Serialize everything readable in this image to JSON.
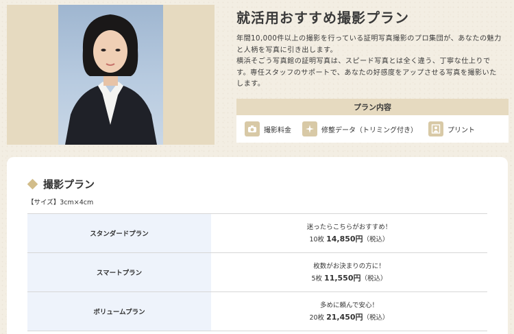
{
  "header": {
    "title": "就活用おすすめ撮影プラン",
    "description_lines": [
      "年間10,000件以上の撮影を行っている証明写真撮影のプロ集団が、あなたの魅力",
      "と人柄を写真に引き出します。",
      "横浜そごう写真館の証明写真は、スピード写真とは全く違う、丁寧な仕上りで",
      "す。専任スタッフのサポートで、あなたの好感度をアップさせる写真を撮影いた",
      "します。"
    ]
  },
  "plan_contents": {
    "heading": "プラン内容",
    "items": [
      {
        "icon": "camera-icon",
        "label": "撮影料金"
      },
      {
        "icon": "sparkle-icon",
        "label": "修整データ（トリミング付き）"
      },
      {
        "icon": "portrait-icon",
        "label": "プリント"
      }
    ]
  },
  "shooting_plan": {
    "title": "撮影プラン",
    "size_label": "【サイズ】3cm×4cm",
    "plans": [
      {
        "name": "スタンダードプラン",
        "tagline": "迷ったらこちらがおすすめ！",
        "count": "10枚",
        "price": "14,850円",
        "tax": "（税込）"
      },
      {
        "name": "スマートプラン",
        "tagline": "枚数がお決まりの方に！",
        "count": "5枚",
        "price": "11,550円",
        "tax": "（税込）"
      },
      {
        "name": "ボリュームプラン",
        "tagline": "多めに頼んで安心！",
        "count": "20枚",
        "price": "21,450円",
        "tax": "（税込）"
      }
    ]
  },
  "colors": {
    "page_bg": "#f3eee3",
    "accent_beige": "#e6dac0",
    "icon_bg": "#d8c9a6",
    "row_name_bg": "#eef3fb"
  }
}
